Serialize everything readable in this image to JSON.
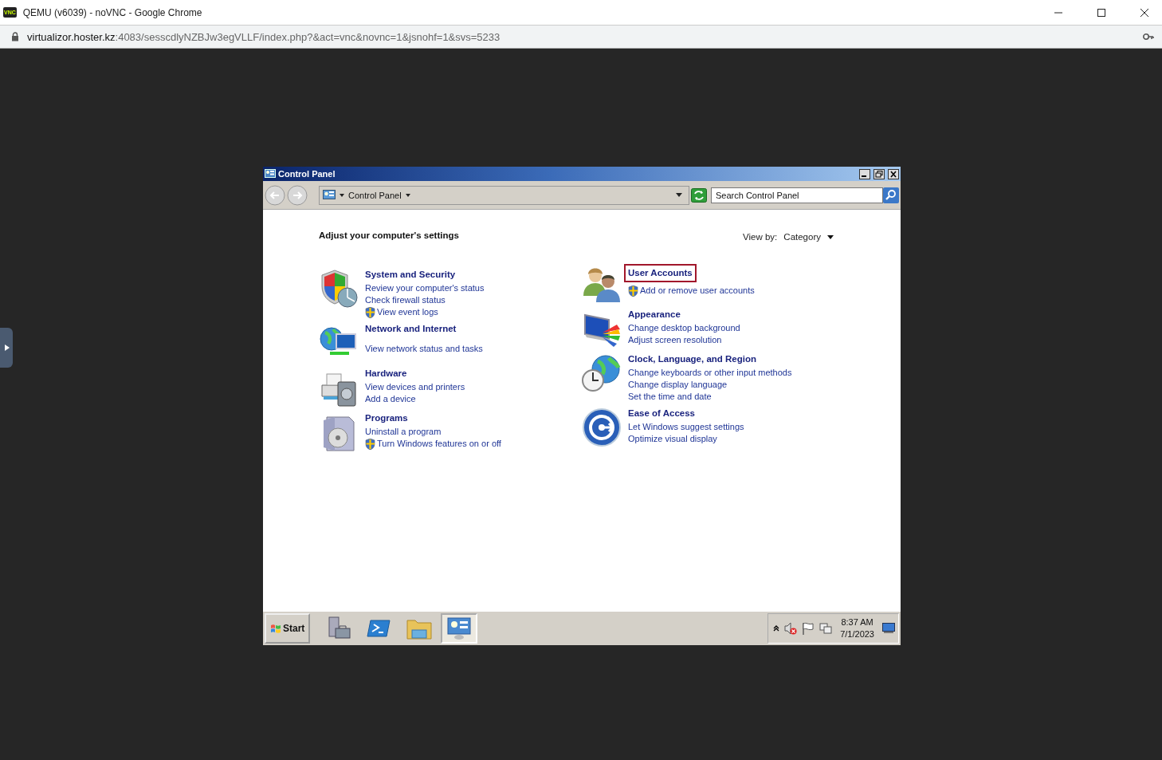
{
  "browser": {
    "favicon_text": "VNC",
    "title": "QEMU (v6039) - noVNC - Google Chrome",
    "url_host": "virtualizor.hoster.kz",
    "url_rest": ":4083/sesscdlyNZBJw3egVLLF/index.php?&act=vnc&novnc=1&jsnohf=1&svs=5233"
  },
  "window": {
    "title": "Control Panel",
    "breadcrumb": "Control Panel",
    "search": {
      "placeholder": "Search Control Panel"
    },
    "heading": "Adjust your computer's settings",
    "view_by": {
      "label": "View by:",
      "value": "Category"
    },
    "columns": [
      [
        {
          "kind": "security",
          "title": "System and Security",
          "focused": false,
          "links": [
            {
              "text": "Review your computer's status",
              "shield": false
            },
            {
              "text": "Check firewall status",
              "shield": false
            },
            {
              "text": "View event logs",
              "shield": true
            }
          ]
        },
        {
          "kind": "network",
          "title": "Network and Internet",
          "focused": false,
          "links": [
            {
              "text": "View network status and tasks",
              "shield": false
            }
          ]
        },
        {
          "kind": "hardware",
          "title": "Hardware",
          "focused": false,
          "links": [
            {
              "text": "View devices and printers",
              "shield": false
            },
            {
              "text": "Add a device",
              "shield": false
            }
          ]
        },
        {
          "kind": "programs",
          "title": "Programs",
          "focused": false,
          "links": [
            {
              "text": "Uninstall a program",
              "shield": false
            },
            {
              "text": "Turn Windows features on or off",
              "shield": true
            }
          ]
        }
      ],
      [
        {
          "kind": "users",
          "title": "User Accounts",
          "focused": true,
          "links": [
            {
              "text": "Add or remove user accounts",
              "shield": true
            }
          ]
        },
        {
          "kind": "appearance",
          "title": "Appearance",
          "focused": false,
          "links": [
            {
              "text": "Change desktop background",
              "shield": false
            },
            {
              "text": "Adjust screen resolution",
              "shield": false
            }
          ]
        },
        {
          "kind": "clock",
          "title": "Clock, Language, and Region",
          "focused": false,
          "links": [
            {
              "text": "Change keyboards or other input methods",
              "shield": false
            },
            {
              "text": "Change display language",
              "shield": false
            },
            {
              "text": "Set the time and date",
              "shield": false
            }
          ]
        },
        {
          "kind": "ease",
          "title": "Ease of Access",
          "focused": false,
          "links": [
            {
              "text": "Let Windows suggest settings",
              "shield": false
            },
            {
              "text": "Optimize visual display",
              "shield": false
            }
          ]
        }
      ]
    ]
  },
  "taskbar": {
    "start": "Start",
    "items": [
      {
        "kind": "server",
        "selected": false
      },
      {
        "kind": "shell",
        "selected": false
      },
      {
        "kind": "folder",
        "selected": false
      },
      {
        "kind": "panel",
        "selected": true
      }
    ],
    "time": "8:37 AM",
    "date": "7/1/2023"
  }
}
